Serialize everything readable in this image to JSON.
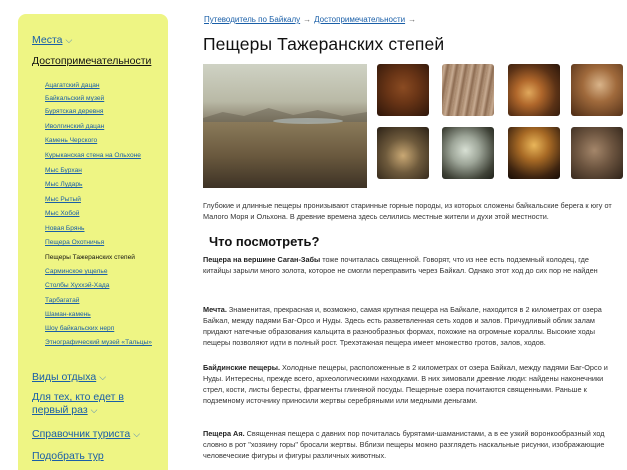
{
  "sidebar": {
    "sections": {
      "places": "Места",
      "sights": "Достопримечательности",
      "leisure": "Виды отдыха",
      "first_time": "Для тех, кто едет в первый раз",
      "handbook": "Справочник туриста",
      "tour": "Подобрать тур"
    },
    "items": [
      "Ацагатский дацан",
      "Байкальский музей",
      "Бурятская деревня",
      "Иволгинский дацан",
      "Камень Черского",
      "Курыканская стена на Ольхоне",
      "Мыс Бурхан",
      "Мыс Лударь",
      "Мыс Рытый",
      "Мыс Хобой",
      "Новая Брянь",
      "Пещера Охотничья",
      "Пещеры Тажеранских степей",
      "Сарминское ущелье",
      "Столбы Хуххэй-Хада",
      "Тарбагатай",
      "Шаман-камень",
      "Шоу байкальских нерп",
      "Этнографический музей «Тальцы»"
    ]
  },
  "breadcrumbs": {
    "first": "Путеводитель по Байкалу",
    "second": "Достопримечательности",
    "sep": "→"
  },
  "page": {
    "title": "Пещеры Тажеранских степей",
    "intro": "Глубокие и длинные пещеры пронизывают старинные горные породы, из которых сложены байкальские берега к югу от Малого Моря и Ольхона. В древние времена здесь селились местные жители и духи этой местности.",
    "what_to_see": "Что посмотреть?",
    "p1_bold": "Пещера на вершине Саган-Забы",
    "p1_text": " тоже почиталась священной. Говорят, что из нее есть подземный колодец, где китайцы зарыли много золота, которое не смогли переправить через Байкал. Однако этот ход до сих пор не найден",
    "p2_bold": "Мечта.",
    "p2_text": " Знаменитая, прекрасная и, возможно, самая крупная пещера на Байкале, находится в 2 километрах от озера Байкал, между падями Баг-Орсо и Нуды. Здесь есть разветвленная сеть ходов и залов. Причудливый облик залам придают натечные образования кальцита в разнообразных формах, похожие на огромные кораллы. Высокие ходы пещеры позволяют идти в полный рост. Трехэтажная пещера имеет множество гротов, залов, ходов.",
    "p3_bold": "Байдинские пещеры.",
    "p3_text": " Холодные пещеры, расположенные в 2 километрах от озера Байкал, между падями Баг-Орсо и Нуды. Интересны, прежде всего, археологическими находками. В них зимовали древние люди: найдены наконечники стрел, кости, листы бересты, фрагменты глиняной посуды. Пещерные озера почитаются священными. Раньше к подземному источнику приносили жертвы серебряными или медными деньгами.",
    "p4_bold": "Пещера Ая.",
    "p4_text": " Священная пещера с давних пор почиталась бурятами-шаманистами, а в ее узкий воронкообразный ход словно в рот \"хозяину горы\" бросали жертвы. Вблизи пещеры можно разглядеть наскальные рисунки, изображающие человеческие фигуры и фигуры различных животных."
  },
  "icons": {
    "chevron": "chevron-down-icon"
  },
  "colors": {
    "sidebar_bg": "#eef584",
    "link": "#1a5fa8"
  }
}
